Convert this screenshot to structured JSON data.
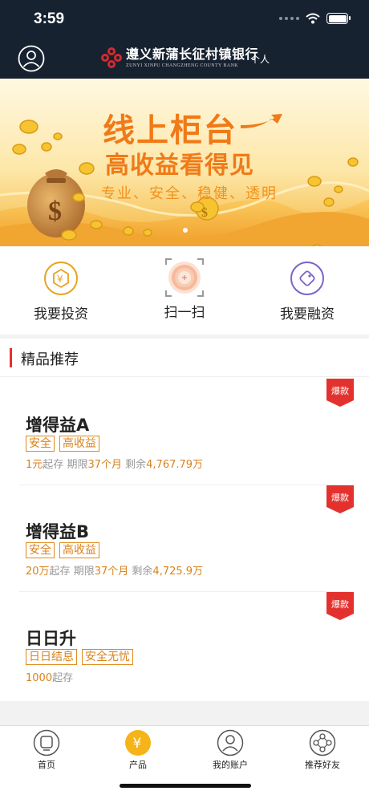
{
  "status_bar": {
    "time": "3:59"
  },
  "header": {
    "bank_name_cn": "遵义新蒲长征村镇银行",
    "bank_name_en": "ZUNYI XINPU CHANGZHENG COUNTY BANK",
    "mode_label": "个人"
  },
  "banner": {
    "title": "线上柜台",
    "subtitle": "高收益看得见",
    "tagline": "专业、安全、稳健、透明",
    "colors": {
      "accent": "#f07a18",
      "bg_top": "#fff6dc",
      "bg_bottom": "#f6b23a"
    }
  },
  "quick_actions": [
    {
      "label": "我要投资",
      "icon": "yuan-hexagon-icon"
    },
    {
      "label": "扫一扫",
      "icon": "scan-icon"
    },
    {
      "label": "我要融资",
      "icon": "diamond-icon"
    }
  ],
  "section": {
    "title": "精品推荐"
  },
  "products": [
    {
      "name": "增得益A",
      "badge": "爆款",
      "tags": [
        "安全",
        "高收益"
      ],
      "min": "1元",
      "min_suffix": "起存",
      "term_prefix": "期限",
      "term": "37个月",
      "remain_prefix": "剩余",
      "remain": "4,767.79万"
    },
    {
      "name": "增得益B",
      "badge": "爆款",
      "tags": [
        "安全",
        "高收益"
      ],
      "min": "20万",
      "min_suffix": "起存",
      "term_prefix": "期限",
      "term": "37个月",
      "remain_prefix": "剩余",
      "remain": "4,725.9万"
    },
    {
      "name": "日日升",
      "badge": "爆款",
      "tags": [
        "日日结息",
        "安全无忧"
      ],
      "min": "1000",
      "min_suffix": "起存"
    }
  ],
  "tabbar": [
    {
      "label": "首页",
      "icon": "home-icon",
      "active": false
    },
    {
      "label": "产品",
      "icon": "yuan-icon",
      "active": true
    },
    {
      "label": "我的账户",
      "icon": "user-icon",
      "active": false
    },
    {
      "label": "推荐好友",
      "icon": "share-network-icon",
      "active": false
    }
  ],
  "colors": {
    "navy": "#172231",
    "orange": "#e08a1e",
    "red": "#e3312e",
    "active_tab": "#f5b417"
  }
}
